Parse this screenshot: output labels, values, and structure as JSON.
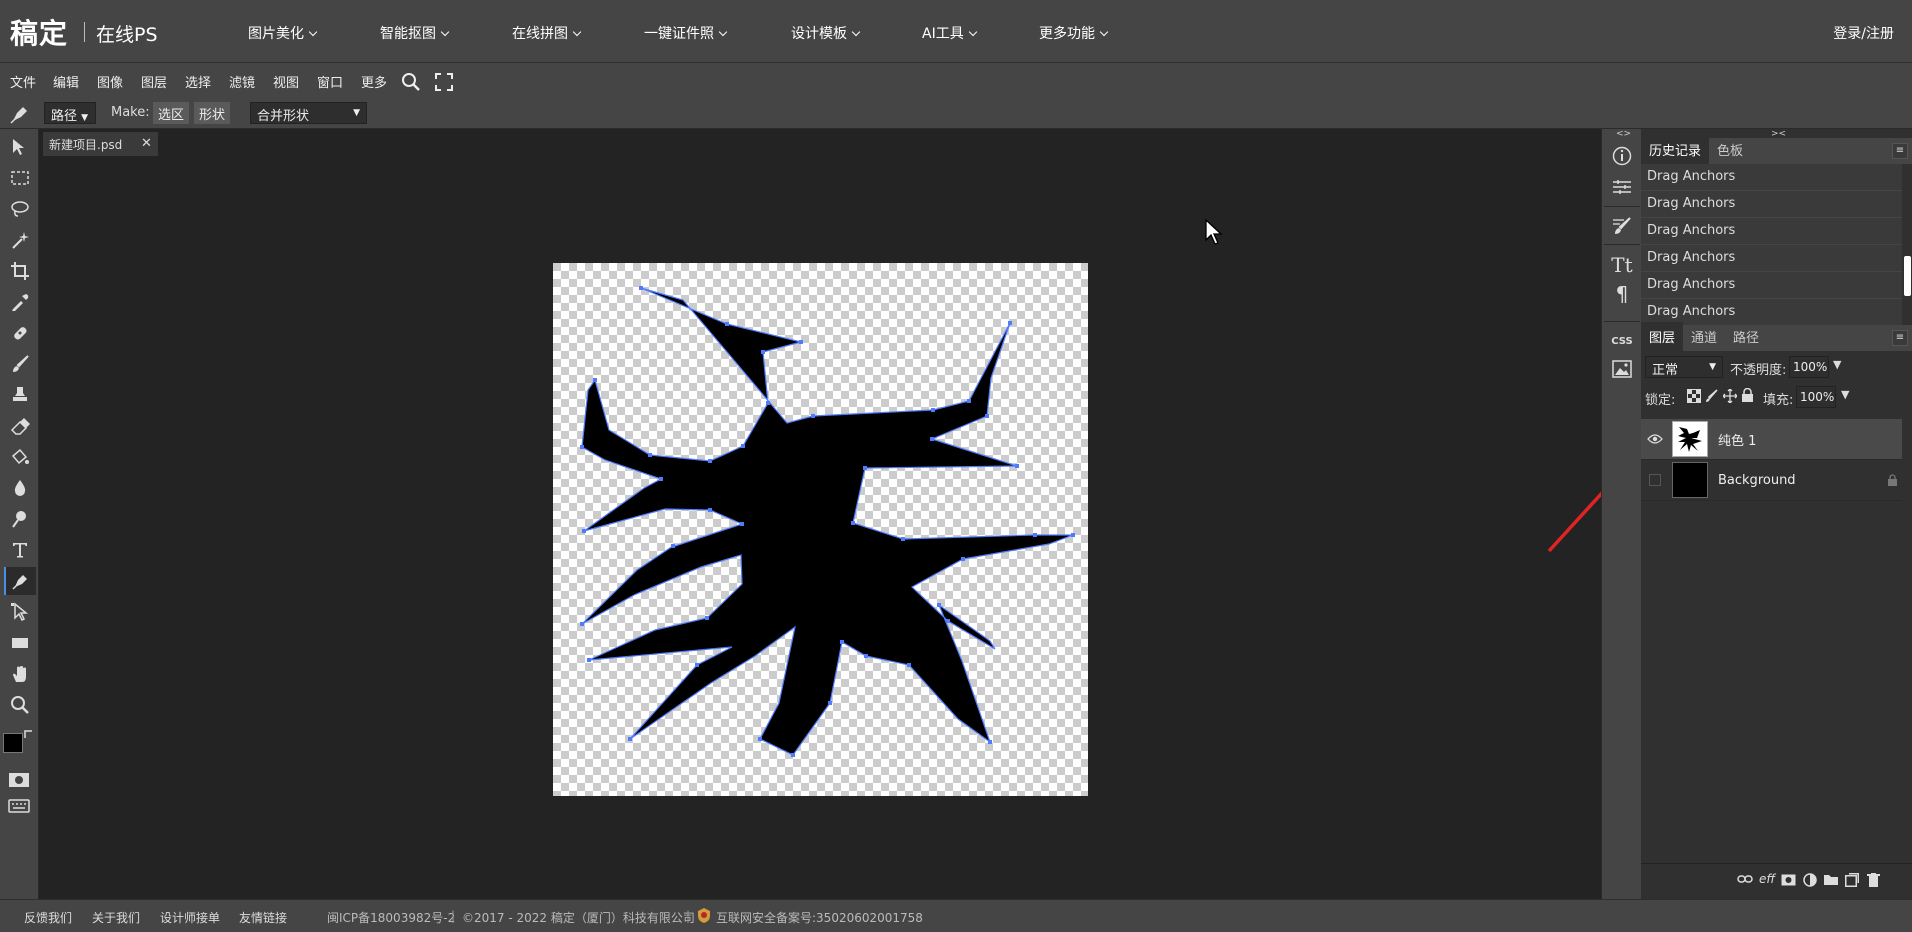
{
  "brand": {
    "logo": "稿定",
    "subtitle": "在线PS"
  },
  "nav": [
    {
      "label": "图片美化"
    },
    {
      "label": "智能抠图"
    },
    {
      "label": "在线拼图"
    },
    {
      "label": "一键证件照"
    },
    {
      "label": "设计模板"
    },
    {
      "label": "AI工具"
    },
    {
      "label": "更多功能"
    }
  ],
  "login": "登录/注册",
  "menu": [
    "文件",
    "编辑",
    "图像",
    "图层",
    "选择",
    "滤镜",
    "视图",
    "窗口",
    "更多"
  ],
  "options": {
    "mode_value": "路径",
    "make_label": "Make:",
    "make_selection": "选区",
    "make_shape": "形状",
    "combine_value": "合并形状"
  },
  "document_tab": {
    "name": "新建项目.psd",
    "close": "✕"
  },
  "history": {
    "tabs": [
      "历史记录",
      "色板"
    ],
    "items": [
      "Drag Anchors",
      "Drag Anchors",
      "Drag Anchors",
      "Drag Anchors",
      "Drag Anchors",
      "Drag Anchors"
    ]
  },
  "layers": {
    "tabs": [
      "图层",
      "通道",
      "路径"
    ],
    "blend_mode": "正常",
    "opacity_label": "不透明度:",
    "opacity_value": "100%",
    "lock_label": "锁定:",
    "fill_label": "填充:",
    "fill_value": "100%",
    "items": [
      {
        "name": "纯色 1",
        "visible": true,
        "locked": false
      },
      {
        "name": "Background",
        "visible": false,
        "locked": true
      }
    ],
    "footer_icons": [
      "link-icon",
      "effects-icon",
      "mask-icon",
      "adjustment-icon",
      "folder-icon",
      "new-layer-icon",
      "trash-icon"
    ]
  },
  "right_icons": [
    "info-icon",
    "adjustments-icon",
    "brush-settings-icon",
    "character-icon",
    "paragraph-icon",
    "css-icon",
    "image-icon"
  ],
  "css_label": "CSS",
  "effects_label": "eff",
  "footer": {
    "links": [
      "反馈我们",
      "关于我们",
      "设计师接单",
      "友情链接"
    ],
    "icp": "闽ICP备18003982号-2",
    "copyright": "©2017 - 2022 稿定（厦门）科技有限公司",
    "security": "互联网安全备案号:35020602001758"
  },
  "colors": {
    "accent": "#4a8ee6",
    "arrow": "#e02424",
    "path": "#4f7bff"
  }
}
